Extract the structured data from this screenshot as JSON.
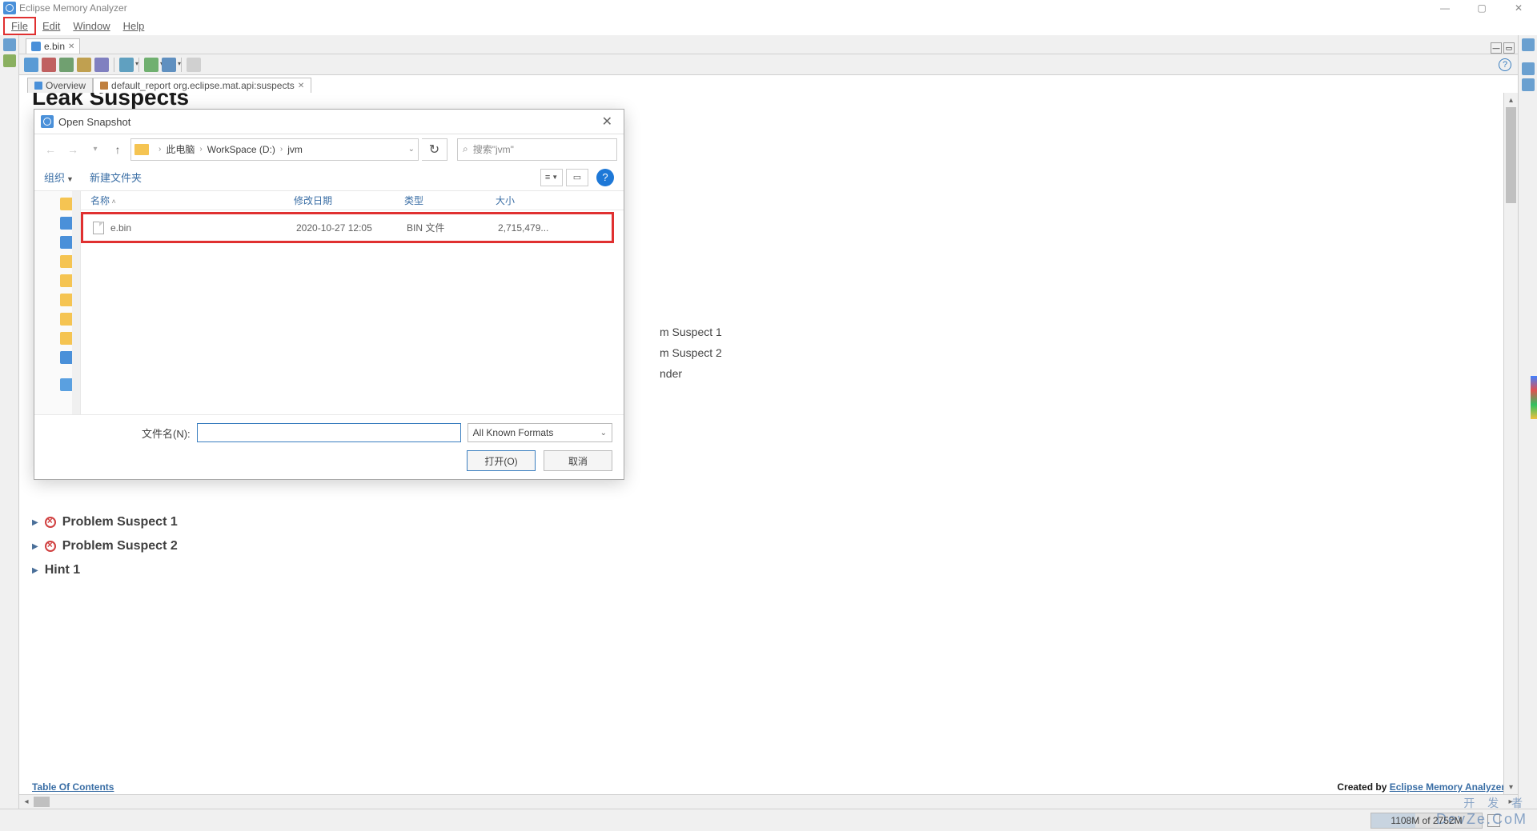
{
  "window": {
    "title": "Eclipse Memory Analyzer"
  },
  "menu": {
    "file": "File",
    "edit": "Edit",
    "window": "Window",
    "help": "Help"
  },
  "editor_tab": {
    "label": "e.bin"
  },
  "inner_tabs": {
    "overview": "Overview",
    "report": "default_report org.eclipse.mat.api:suspects"
  },
  "content": {
    "heading": "Leak Suspects",
    "bg_line1": "m Suspect 1",
    "bg_line2": "m Suspect 2",
    "bg_line3": "nder",
    "suspect1": "Problem Suspect 1",
    "suspect2": "Problem Suspect 2",
    "hint1": "Hint 1",
    "toc": "Table Of Contents",
    "created_by_prefix": "Created by ",
    "created_by_link": "Eclipse Memory Analyzer"
  },
  "status": {
    "memory": "1108M of 2752M"
  },
  "watermark": {
    "cn": "开 发 者",
    "en": "DevZe.CoM"
  },
  "dialog": {
    "title": "Open Snapshot",
    "breadcrumb": {
      "root": "此电脑",
      "drive": "WorkSpace (D:)",
      "folder": "jvm"
    },
    "search_placeholder": "搜索\"jvm\"",
    "toolbar": {
      "organize": "组织",
      "new_folder": "新建文件夹"
    },
    "columns": {
      "name": "名称",
      "date": "修改日期",
      "type": "类型",
      "size": "大小"
    },
    "file": {
      "name": "e.bin",
      "date": "2020-10-27 12:05",
      "type": "BIN 文件",
      "size": "2,715,479..."
    },
    "footer": {
      "filename_label": "文件名(N):",
      "format": "All Known Formats",
      "open": "打开(O)",
      "cancel": "取消"
    }
  }
}
